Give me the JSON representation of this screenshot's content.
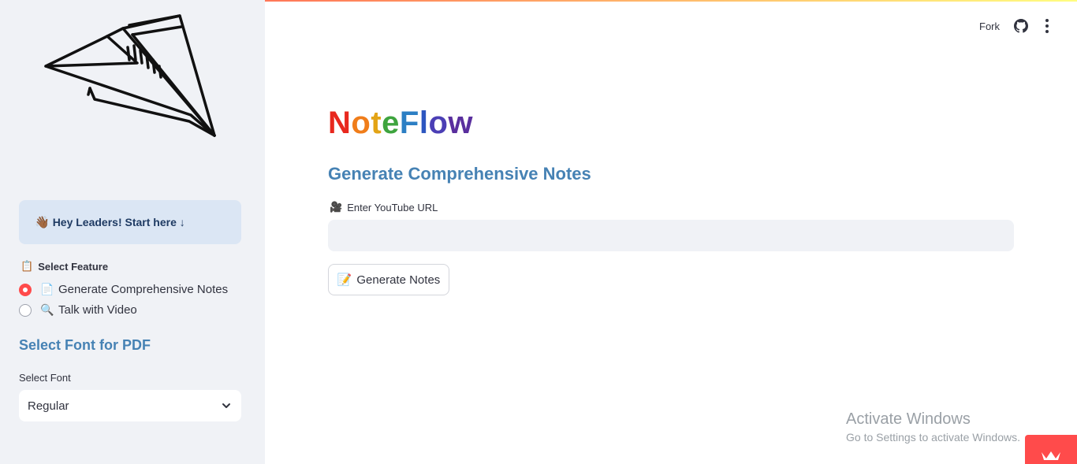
{
  "header": {
    "fork_label": "Fork"
  },
  "sidebar": {
    "hey_text": "Hey Leaders! Start here ↓",
    "hey_emoji": "👋🏾",
    "feature_label": "Select Feature",
    "feature_emoji": "📋",
    "options": [
      {
        "emoji": "📄",
        "label": "Generate Comprehensive Notes",
        "selected": true
      },
      {
        "emoji": "🔍",
        "label": "Talk with Video",
        "selected": false
      }
    ],
    "font_heading": "Select Font for PDF",
    "font_select_label": "Select Font",
    "font_select_value": "Regular"
  },
  "main": {
    "title_letters": [
      "N",
      "o",
      "t",
      "e",
      "F",
      "l",
      "o",
      "w"
    ],
    "title_colors": [
      "#e8281e",
      "#f07d1a",
      "#e3a416",
      "#3ea43e",
      "#2c7fc4",
      "#2d56c0",
      "#4b3fb5",
      "#5a2f9e"
    ],
    "subtitle": "Generate Comprehensive Notes",
    "url_label": "Enter YouTube URL",
    "url_emoji": "🎥",
    "url_value": "",
    "button_label": "Generate Notes",
    "button_emoji": "📝"
  },
  "watermark": {
    "line1": "Activate Windows",
    "line2": "Go to Settings to activate Windows."
  },
  "colors": {
    "accent": "#ff4b4b",
    "heading_blue": "#4682b4",
    "sidebar_bg": "#f0f2f6",
    "info_bg": "#dbe6f4"
  }
}
